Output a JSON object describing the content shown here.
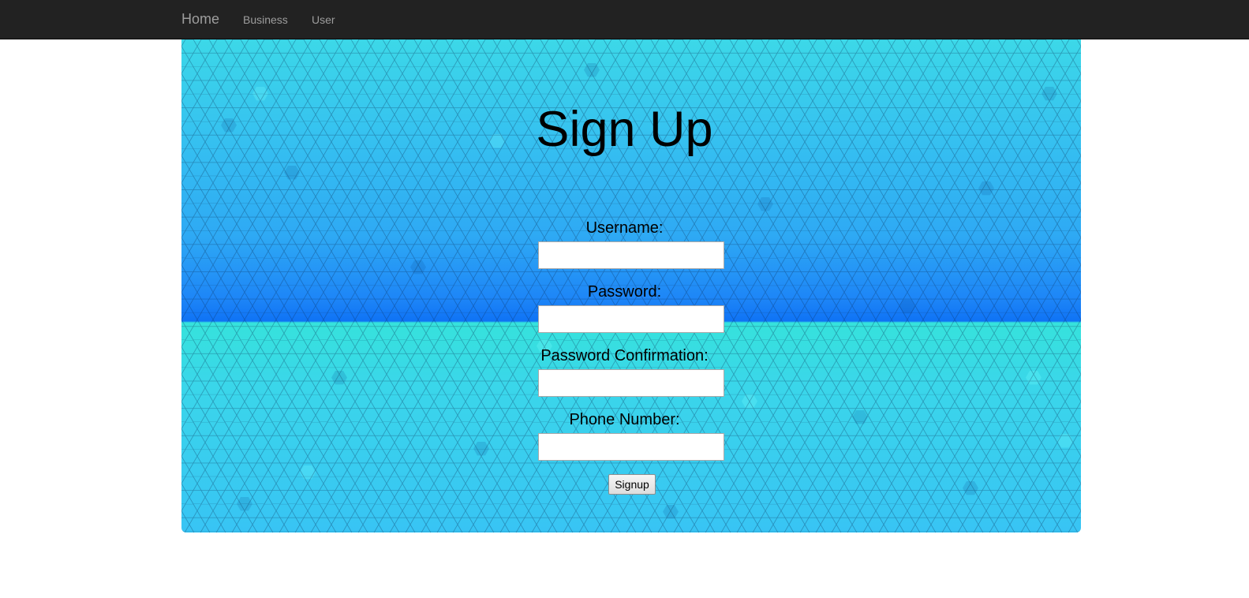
{
  "navbar": {
    "brand": "Home",
    "links": [
      "Business",
      "User"
    ]
  },
  "form": {
    "title": "Sign Up",
    "fields": [
      {
        "label": "Username:",
        "value": ""
      },
      {
        "label": "Password:",
        "value": ""
      },
      {
        "label": "Password Confirmation:",
        "value": ""
      },
      {
        "label": "Phone Number:",
        "value": ""
      }
    ],
    "submit_label": "Signup"
  },
  "colors": {
    "navbar_bg": "#222222",
    "nav_text": "#9d9d9d",
    "hero_top": "#3cd8e8",
    "hero_mid": "#0f73f5",
    "hero_bottom": "#38c4f4"
  }
}
